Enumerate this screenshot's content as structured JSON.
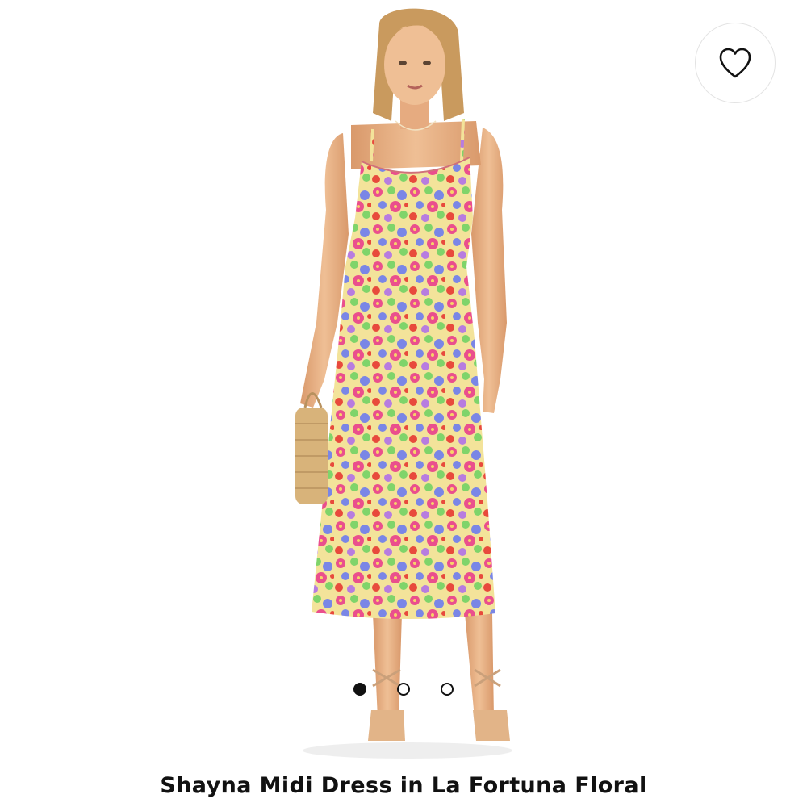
{
  "product": {
    "title": "Shayna Midi Dress in La Fortuna Floral",
    "image_alt": "Model wearing floral slip midi dress holding a woven straw bag"
  },
  "favorite": {
    "icon": "heart-outline-icon",
    "active": false
  },
  "carousel": {
    "count": 3,
    "active_index": 0
  },
  "colors": {
    "ink": "#111111",
    "border": "#e3e3e3",
    "skin": "#e9b48a",
    "hair": "#c99a5e",
    "dress_base": "#f3e39a",
    "floral_pink": "#ea4f8d",
    "floral_blue": "#7a86e6",
    "floral_red": "#e84a3c",
    "floral_green": "#7fd46a",
    "floral_violet": "#b77ce0",
    "bag": "#d8b37a"
  }
}
